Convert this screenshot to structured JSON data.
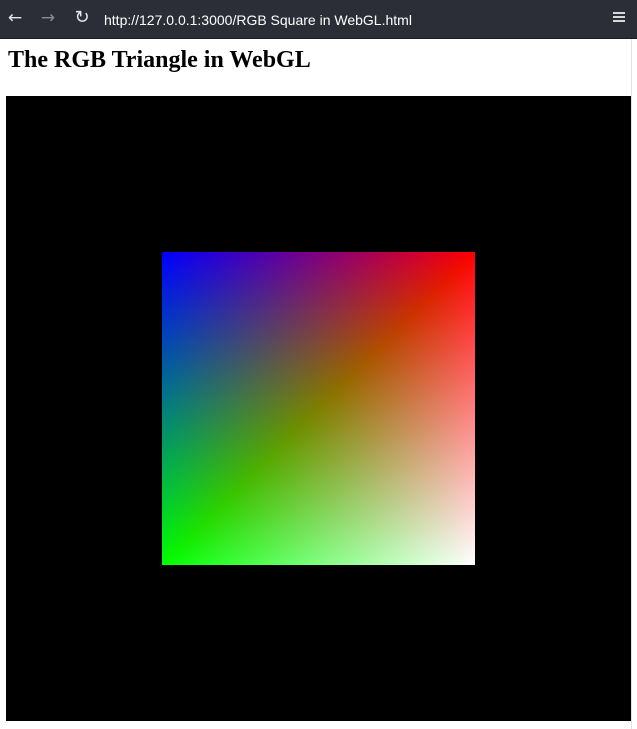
{
  "browser": {
    "url": "http://127.0.0.1:3000/RGB Square in WebGL.html",
    "back_icon": "←",
    "forward_icon": "→",
    "reload_icon": "↻"
  },
  "page": {
    "title": "The RGB Triangle in WebGL"
  },
  "canvas": {
    "background": "#000000",
    "corner_colors": {
      "top_left": "#0000ff",
      "top_right": "#ff0000",
      "bottom_left": "#00ff00",
      "bottom_right": "#ffffff"
    }
  }
}
